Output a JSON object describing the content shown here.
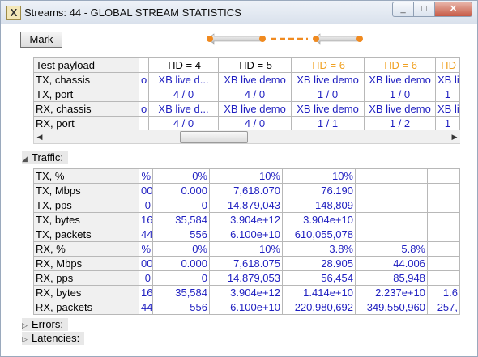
{
  "window": {
    "title": "Streams: 44 - GLOBAL STREAM STATISTICS",
    "icon_letter": "X",
    "min_icon": "_",
    "max_icon": "□",
    "close_icon": "✕"
  },
  "toolbar": {
    "mark_label": "Mark"
  },
  "top_table": {
    "rows": [
      {
        "head": "Test payload",
        "cells": [
          "",
          "TID = 4",
          "TID = 5",
          "TID = 6",
          "TID = 6",
          "TID"
        ]
      },
      {
        "head": "TX, chassis",
        "cells": [
          "o",
          "XB live d...",
          "XB live demo",
          "XB live demo",
          "XB live demo",
          "XB live"
        ]
      },
      {
        "head": "TX, port",
        "cells": [
          "",
          "4 / 0",
          "4 / 0",
          "1 / 0",
          "1 / 0",
          "1"
        ]
      },
      {
        "head": "RX, chassis",
        "cells": [
          "o",
          "XB live d...",
          "XB live demo",
          "XB live demo",
          "XB live demo",
          "XB live"
        ]
      },
      {
        "head": "RX, port",
        "cells": [
          "",
          "4 / 0",
          "4 / 0",
          "1 / 1",
          "1 / 2",
          "1"
        ]
      }
    ]
  },
  "scrollbar": {
    "left_icon": "◀",
    "right_icon": "▶"
  },
  "sections": {
    "traffic": "Traffic:",
    "errors": "Errors:",
    "latencies": "Latencies:",
    "expanded_icon": "◢",
    "collapsed_icon": "▷"
  },
  "traffic_table": {
    "rows": [
      {
        "head": "TX, %",
        "cells": [
          "%",
          "0%",
          "10%",
          "10%",
          "",
          ""
        ]
      },
      {
        "head": "TX, Mbps",
        "cells": [
          "00",
          "0.000",
          "7,618.070",
          "76.190",
          "",
          ""
        ]
      },
      {
        "head": "TX, pps",
        "cells": [
          "0",
          "0",
          "14,879,043",
          "148,809",
          "",
          ""
        ]
      },
      {
        "head": "TX, bytes",
        "cells": [
          "16",
          "35,584",
          "3.904e+12",
          "3.904e+10",
          "",
          ""
        ]
      },
      {
        "head": "TX, packets",
        "cells": [
          "44",
          "556",
          "6.100e+10",
          "610,055,078",
          "",
          ""
        ]
      },
      {
        "head": "RX, %",
        "cells": [
          "%",
          "0%",
          "10%",
          "3.8%",
          "5.8%",
          ""
        ]
      },
      {
        "head": "RX, Mbps",
        "cells": [
          "00",
          "0.000",
          "7,618.075",
          "28.905",
          "44.006",
          ""
        ]
      },
      {
        "head": "RX, pps",
        "cells": [
          "0",
          "0",
          "14,879,053",
          "56,454",
          "85,948",
          ""
        ]
      },
      {
        "head": "RX, bytes",
        "cells": [
          "16",
          "35,584",
          "3.904e+12",
          "1.414e+10",
          "2.237e+10",
          "1.6"
        ]
      },
      {
        "head": "RX, packets",
        "cells": [
          "44",
          "556",
          "6.100e+10",
          "220,980,692",
          "349,550,960",
          "257,"
        ]
      }
    ]
  }
}
